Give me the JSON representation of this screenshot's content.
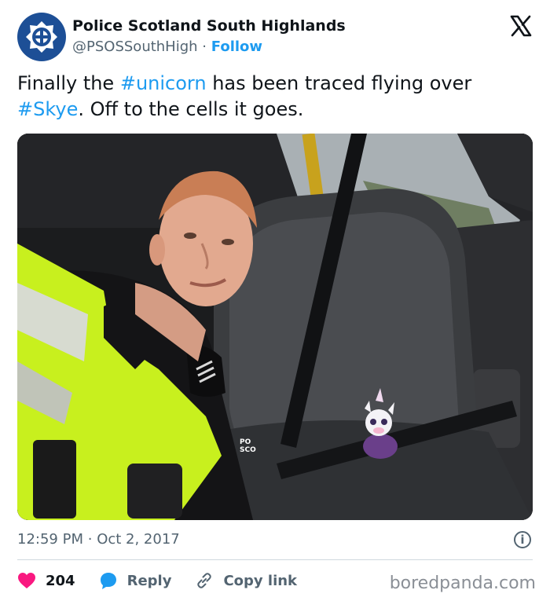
{
  "author": {
    "name": "Police Scotland South Highlands",
    "handle": "@PSOSSouthHigh",
    "separator": "·",
    "follow_label": "Follow"
  },
  "tweet": {
    "text_1": "Finally the ",
    "hashtag_1": "#unicorn",
    "text_2": " has been traced flying over ",
    "hashtag_2": "#Skye",
    "text_3": ". Off to the cells it goes."
  },
  "photo_text": {
    "badge": "PO\nSCO"
  },
  "meta": {
    "time": "12:59 PM",
    "separator": "·",
    "date": "Oct 2, 2017",
    "info_icon": "i"
  },
  "actions": {
    "likes": "204",
    "reply_label": "Reply",
    "copy_label": "Copy link"
  },
  "watermark": "boredpanda.com",
  "colors": {
    "accent": "#1d9bf0",
    "like": "#f91880",
    "muted": "#536471",
    "avatar_bg": "#1d4f96",
    "vest": "#c8f01e"
  },
  "icons": [
    "police-badge-icon",
    "x-logo-icon",
    "info-icon",
    "heart-icon",
    "reply-icon",
    "link-icon"
  ]
}
